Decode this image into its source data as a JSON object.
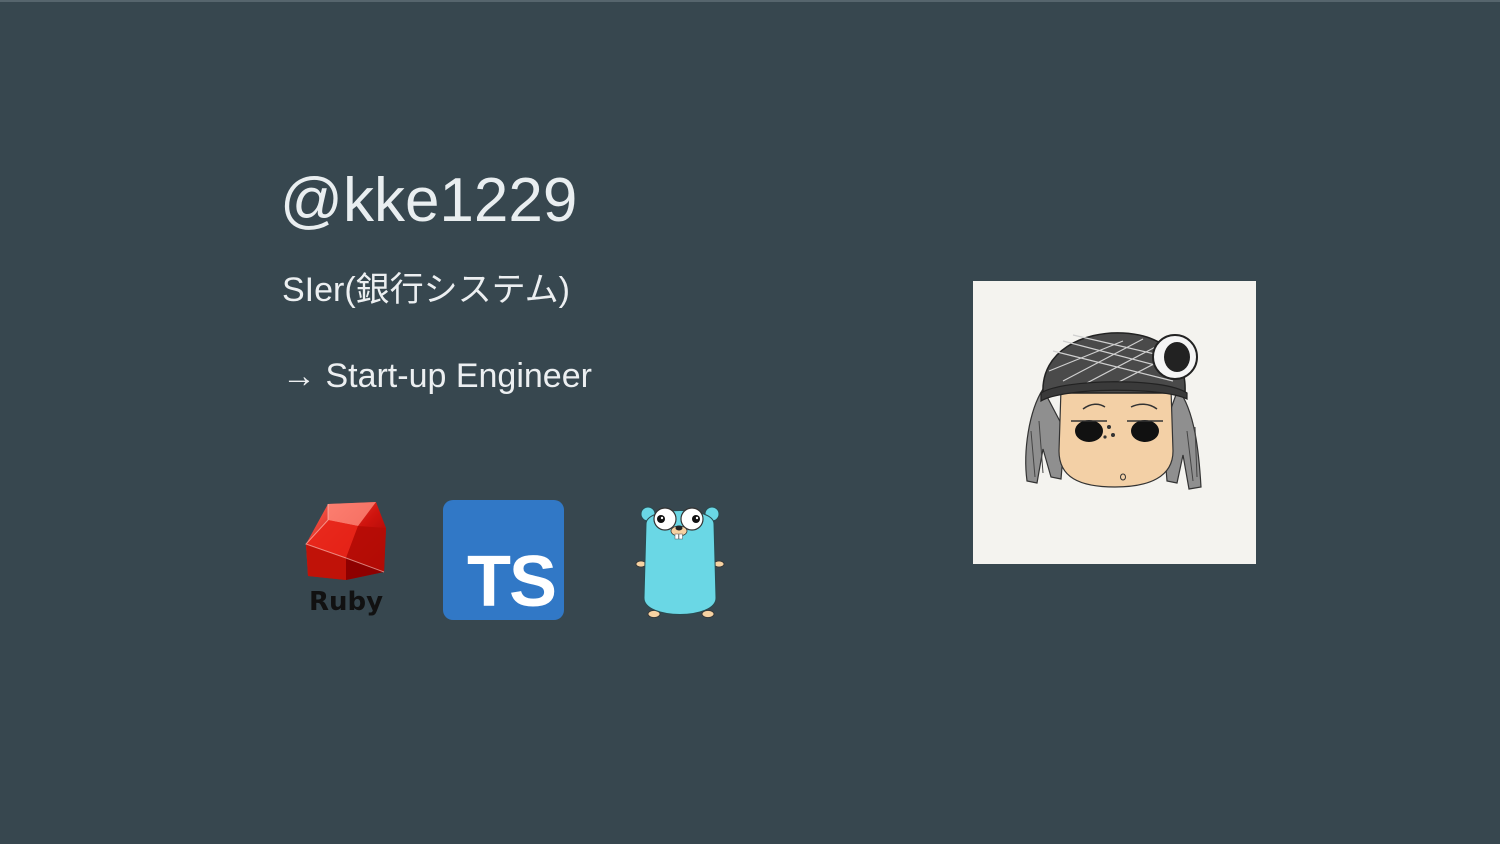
{
  "slide": {
    "handle": "@kke1229",
    "career_from": "SIer(銀行システム)",
    "career_to": "→ Start-up Engineer"
  },
  "logos": {
    "ruby": {
      "label": "Ruby",
      "icon": "ruby-gem-icon",
      "color": "#cc1a1a"
    },
    "typescript": {
      "label": "TS",
      "icon": "typescript-icon",
      "color": "#3178c6"
    },
    "go": {
      "icon": "go-gopher-icon",
      "color": "#6ad7e5"
    }
  },
  "avatar": {
    "icon": "hand-drawn-avatar-icon"
  },
  "colors": {
    "background": "#37474f",
    "text": "#eceff1"
  }
}
